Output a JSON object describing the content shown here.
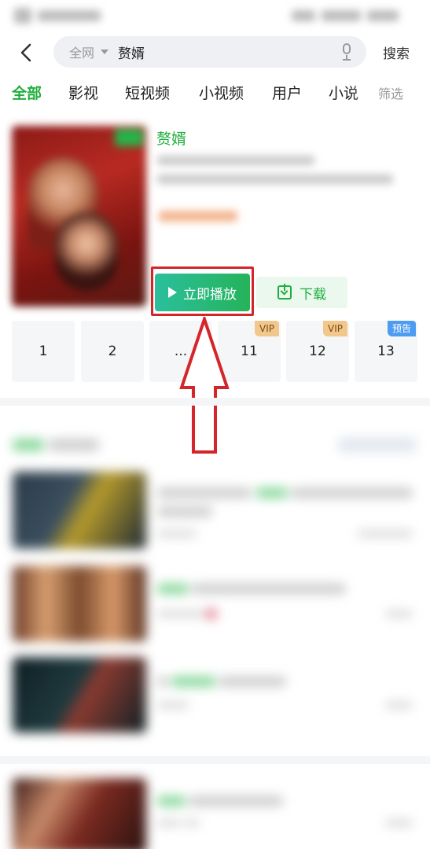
{
  "status_bar": {},
  "header": {
    "back_icon": "chevron-left-icon",
    "search": {
      "scope": "全网",
      "query": "赘婿",
      "mic_icon": "microphone-icon"
    },
    "search_button": "搜索"
  },
  "tabs": {
    "items": [
      "全部",
      "影视",
      "短视频",
      "小视频",
      "用户",
      "小说"
    ],
    "active": "全部",
    "filter": "筛选"
  },
  "result": {
    "title": "赘婿",
    "play_button": "立即播放",
    "download_button": "下载",
    "episodes": [
      {
        "label": "1",
        "badge": ""
      },
      {
        "label": "2",
        "badge": ""
      },
      {
        "label": "...",
        "badge": ""
      },
      {
        "label": "11",
        "badge": "VIP"
      },
      {
        "label": "12",
        "badge": "VIP"
      },
      {
        "label": "13",
        "badge": "预告"
      }
    ]
  },
  "colors": {
    "accent_green": "#1fae3d",
    "annotation_red": "#d4252b",
    "vip_badge": "#f2c78c",
    "preview_badge": "#4e9cf2"
  }
}
